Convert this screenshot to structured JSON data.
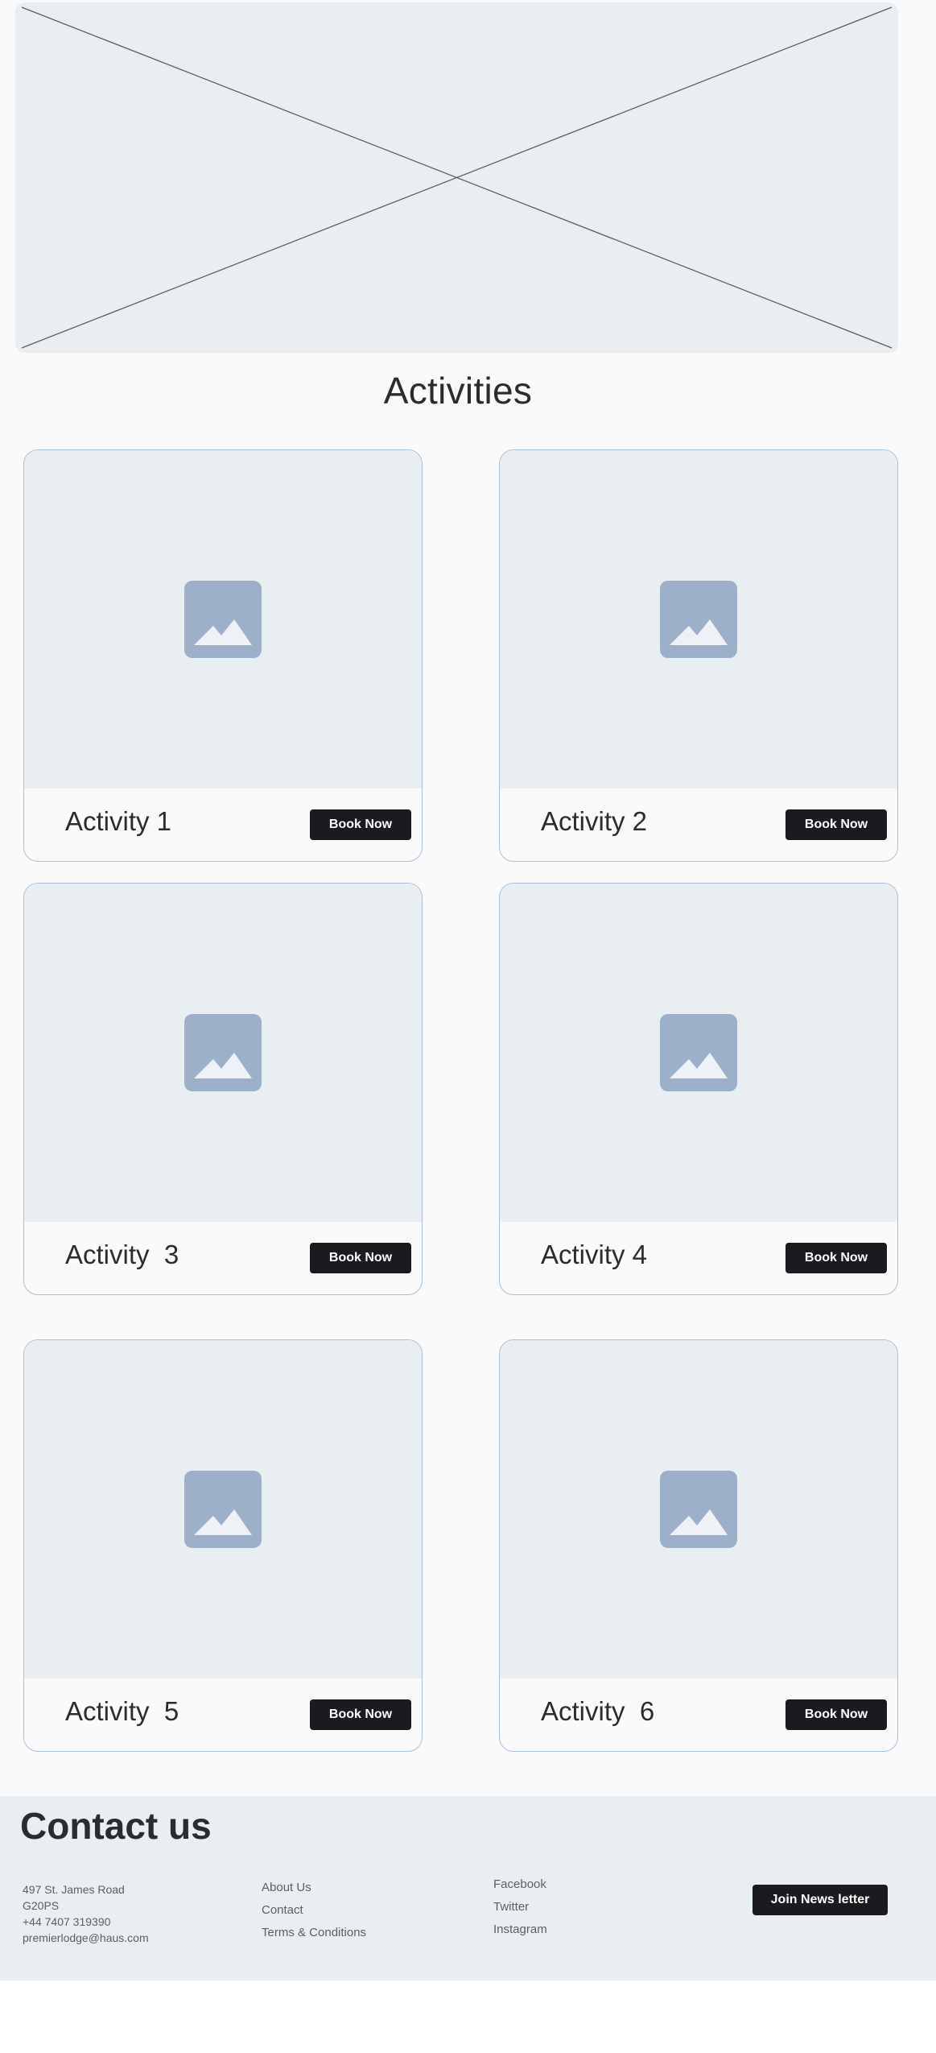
{
  "hero": {
    "icon": "image-placeholder-icon"
  },
  "section": {
    "title": "Activities"
  },
  "activities": [
    {
      "title": "Activity 1",
      "button": "Book Now",
      "icon": "image-icon"
    },
    {
      "title": "Activity 2",
      "button": "Book Now",
      "icon": "image-icon"
    },
    {
      "title": "Activity  3",
      "button": "Book Now",
      "icon": "image-icon"
    },
    {
      "title": "Activity 4",
      "button": "Book Now",
      "icon": "image-icon"
    },
    {
      "title": "Activity  5",
      "button": "Book Now",
      "icon": "image-icon"
    },
    {
      "title": "Activity  6",
      "button": "Book Now",
      "icon": "image-icon"
    }
  ],
  "footer": {
    "title": "Contact us",
    "address": {
      "street": "497 St. James Road",
      "postcode": "G20PS",
      "phone": "+44 7407 319390",
      "email": "premierlodge@haus.com"
    },
    "links_col1": [
      "About Us",
      "Contact",
      "Terms & Conditions"
    ],
    "links_col2": [
      "Facebook",
      "Twitter",
      "Instagram"
    ],
    "newsletter_button": "Join News letter"
  },
  "colors": {
    "button_bg": "#1b1b1f",
    "placeholder_bg": "#e9eef3",
    "icon_fill": "#9cb0c9",
    "card_border": "#aac0d8"
  }
}
